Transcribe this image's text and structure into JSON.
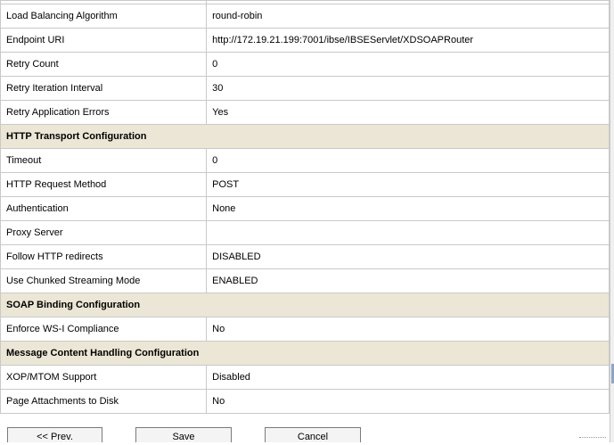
{
  "config": {
    "rows": [
      {
        "type": "sliver"
      },
      {
        "type": "row",
        "label": "Load Balancing Algorithm",
        "value": "round-robin"
      },
      {
        "type": "row",
        "label": "Endpoint URI",
        "value": "http://172.19.21.199:7001/ibse/IBSEServlet/XDSOAPRouter"
      },
      {
        "type": "row",
        "label": "Retry Count",
        "value": "0"
      },
      {
        "type": "row",
        "label": "Retry Iteration Interval",
        "value": "30"
      },
      {
        "type": "row",
        "label": "Retry Application Errors",
        "value": "Yes"
      },
      {
        "type": "section",
        "label": "HTTP Transport Configuration"
      },
      {
        "type": "row",
        "label": "Timeout",
        "value": "0"
      },
      {
        "type": "row",
        "label": "HTTP Request Method",
        "value": "POST"
      },
      {
        "type": "row",
        "label": "Authentication",
        "value": "None"
      },
      {
        "type": "row",
        "label": "Proxy Server",
        "value": ""
      },
      {
        "type": "row",
        "label": "Follow HTTP redirects",
        "value": "DISABLED"
      },
      {
        "type": "row",
        "label": "Use Chunked Streaming Mode",
        "value": "ENABLED"
      },
      {
        "type": "section",
        "label": "SOAP Binding Configuration"
      },
      {
        "type": "row",
        "label": "Enforce WS-I Compliance",
        "value": "No"
      },
      {
        "type": "section",
        "label": "Message Content Handling Configuration"
      },
      {
        "type": "row",
        "label": "XOP/MTOM Support",
        "value": "Disabled"
      },
      {
        "type": "row",
        "label": "Page Attachments to Disk",
        "value": "No"
      }
    ]
  },
  "buttons": {
    "prev_label": "<< Prev.",
    "save_label": "Save",
    "cancel_label": "Cancel"
  },
  "colors": {
    "section_bg": "#ebe6d5",
    "border": "#c9c9c9"
  }
}
